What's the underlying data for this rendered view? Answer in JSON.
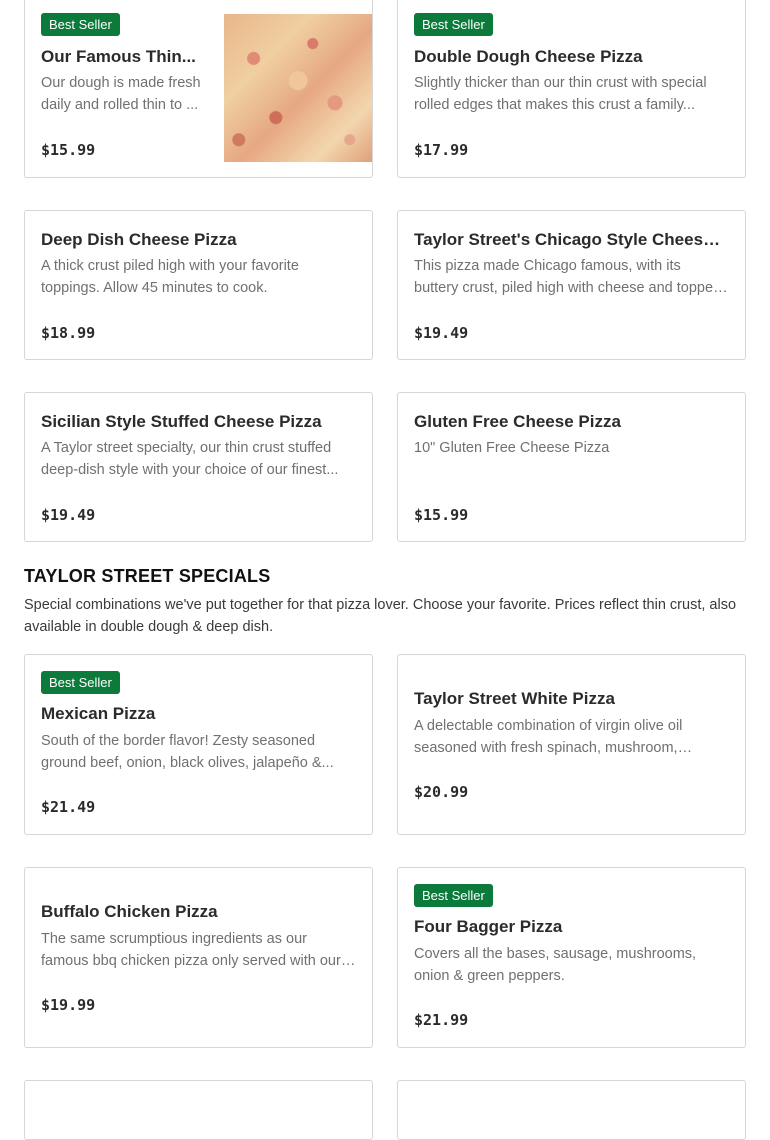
{
  "menu": {
    "items": [
      {
        "badge": "Best Seller",
        "title": "Our Famous Thin...",
        "description": "Our dough is made fresh daily and rolled thin to ...",
        "price": "$15.99",
        "image": "cheese-pizza-photo"
      },
      {
        "badge": "Best Seller",
        "title": "Double Dough Cheese Pizza",
        "description": "Slightly thicker than our thin crust with special rolled edges that makes this crust a family...",
        "price": "$17.99"
      },
      {
        "title": "Deep Dish Cheese Pizza",
        "description": "A thick crust piled high with your favorite toppings. Allow 45 minutes to cook.",
        "price": "$18.99"
      },
      {
        "title": "Taylor Street's Chicago Style Cheese Pizza",
        "description": "This pizza made Chicago famous, with its buttery crust, piled high with cheese and topped with o...",
        "price": "$19.49"
      },
      {
        "title": "Sicilian Style Stuffed Cheese Pizza",
        "description": "A Taylor street specialty, our thin crust stuffed deep-dish style with your choice of our finest...",
        "price": "$19.49"
      },
      {
        "title": "Gluten Free Cheese Pizza",
        "description": "10\" Gluten Free Cheese Pizza",
        "price": "$15.99"
      }
    ]
  },
  "specials": {
    "heading": "TAYLOR STREET SPECIALS",
    "description": "Special combinations we've put together for that pizza lover. Choose your favorite. Prices reflect thin crust, also available in double dough & deep dish.",
    "items": [
      {
        "badge": "Best Seller",
        "title": "Mexican Pizza",
        "description": "South of the border flavor! Zesty seasoned ground beef, onion, black olives, jalapeño &...",
        "price": "$21.49"
      },
      {
        "title": "Taylor Street White Pizza",
        "description": "A delectable combination of virgin olive oil seasoned with fresh spinach, mushroom, onion...",
        "price": "$20.99"
      },
      {
        "title": "Buffalo Chicken Pizza",
        "description": "The same scrumptious ingredients as our famous bbq chicken pizza only served with our hot sau...",
        "price": "$19.99"
      },
      {
        "badge": "Best Seller",
        "title": "Four Bagger Pizza",
        "description": "Covers all the bases, sausage, mushrooms, onion & green peppers.",
        "price": "$21.99"
      }
    ]
  },
  "colors": {
    "badge_bg": "#0b7a3b",
    "card_border": "#d6d6d6",
    "muted_text": "#707070"
  }
}
